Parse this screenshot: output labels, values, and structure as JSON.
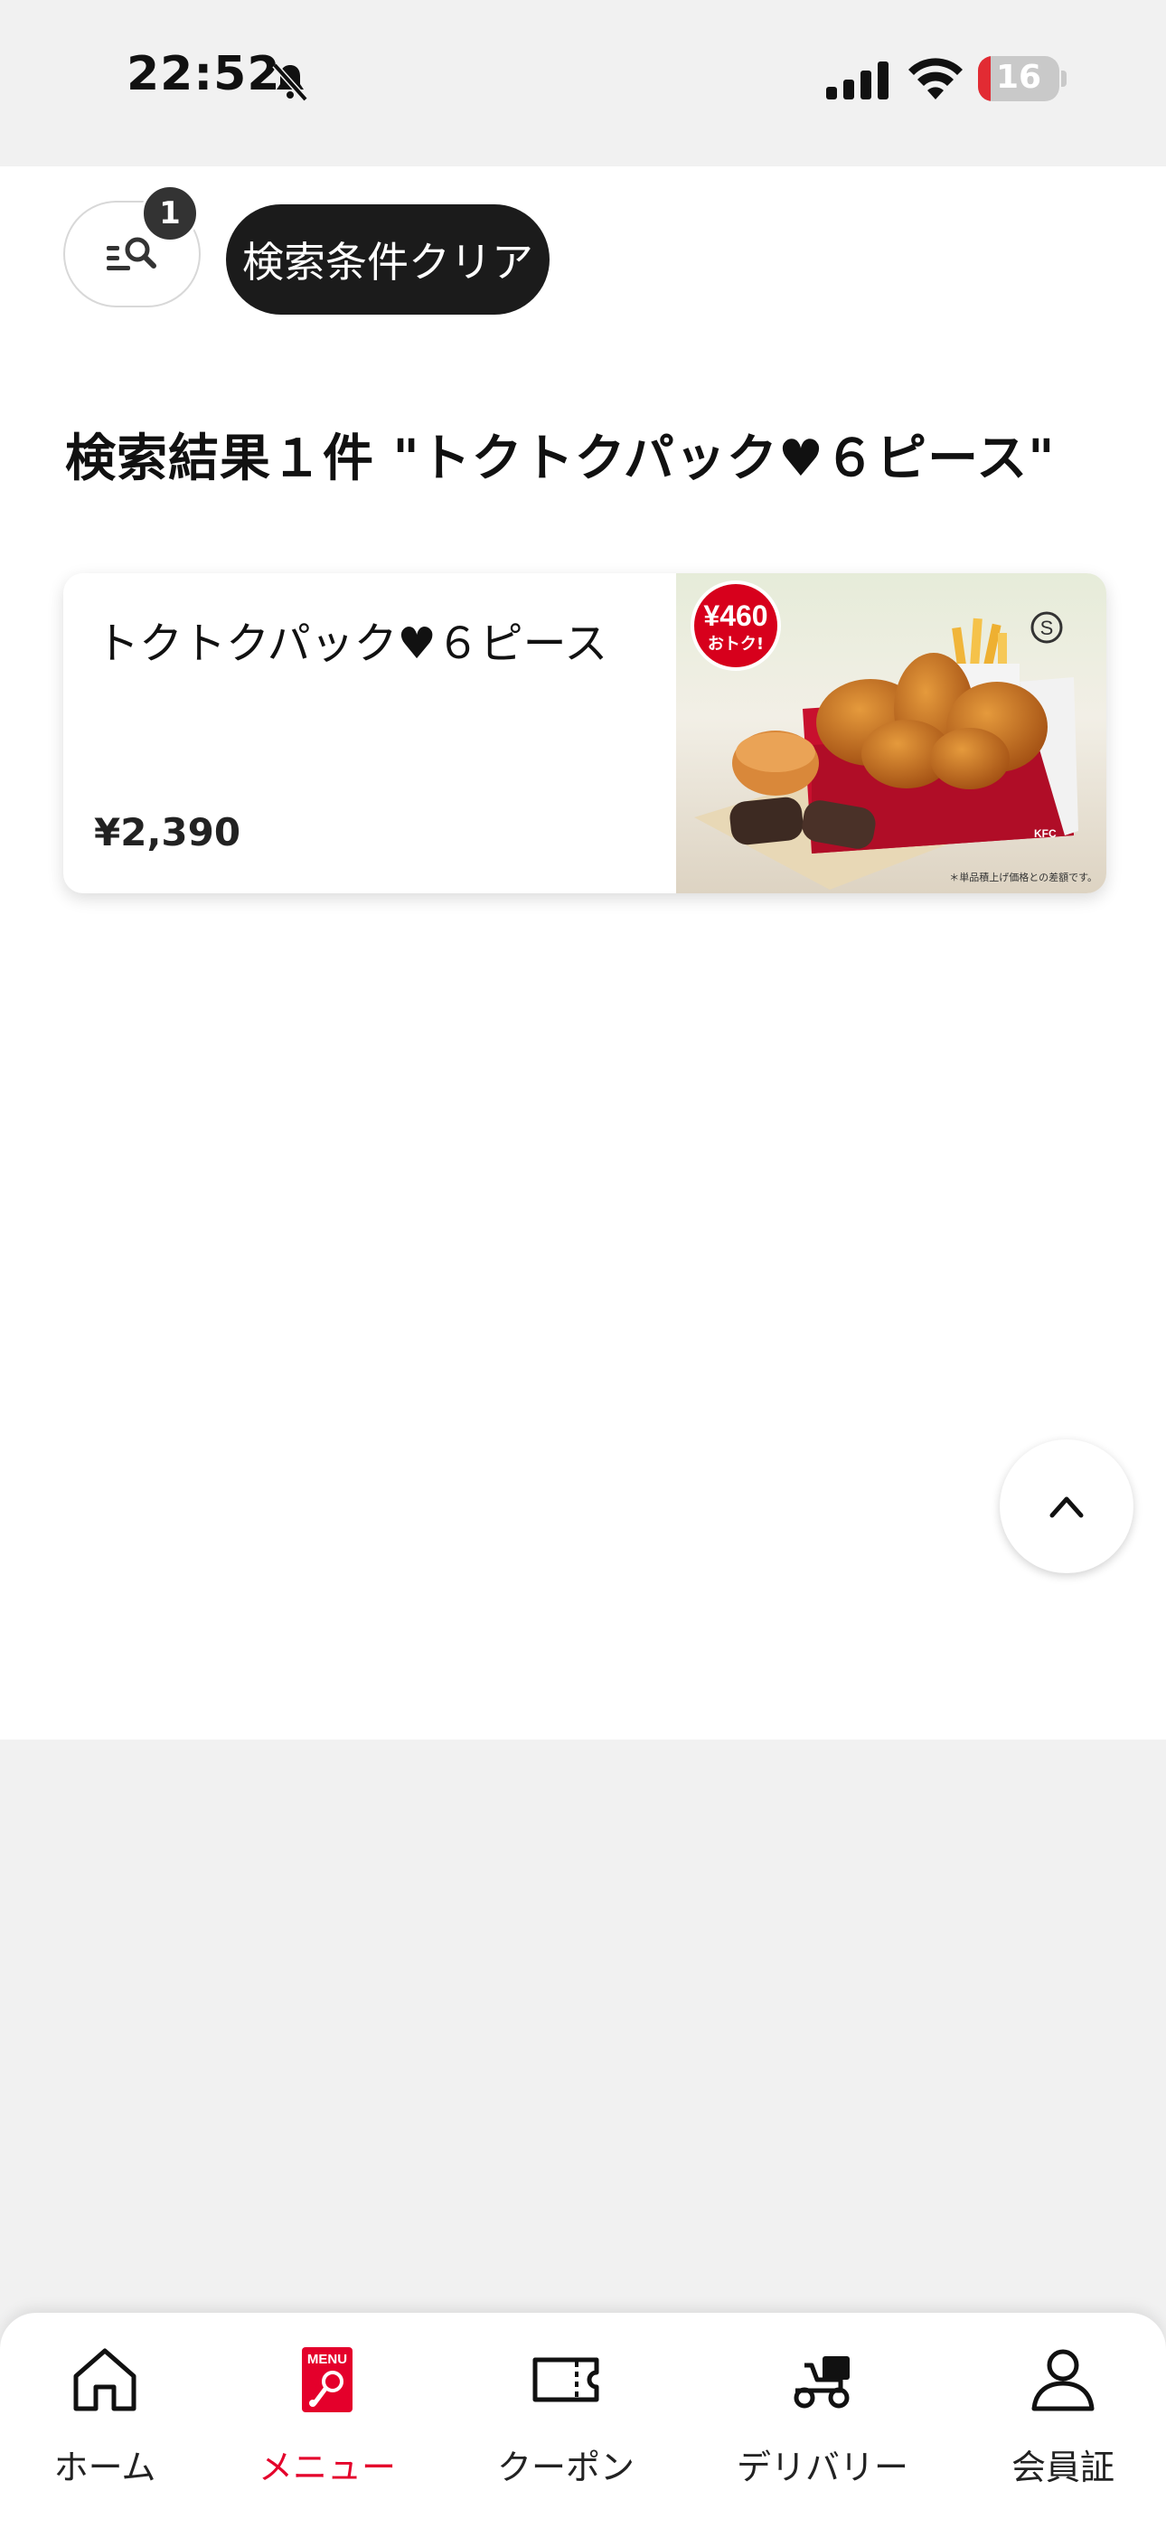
{
  "status_bar": {
    "time": "22:52",
    "battery": "16",
    "battery_level_percent": 16
  },
  "filter": {
    "badge_count": "1",
    "clear_label": "検索条件クリア"
  },
  "results": {
    "title": "検索結果１件 \"トクトクパック♥６ピース\"",
    "items": [
      {
        "name": "トクトクパック♥６ピース",
        "price": "¥2,390",
        "image_badge_price": "¥460",
        "image_badge_sub": "おトク!",
        "image_size_mark": "S",
        "image_brand": "KFC",
        "image_note": "＊単品積上げ価格との差額です。"
      }
    ]
  },
  "tabs": [
    {
      "label": "ホーム",
      "icon": "home-icon",
      "active": false
    },
    {
      "label": "メニュー",
      "icon": "menu-icon",
      "icon_text": "MENU",
      "active": true
    },
    {
      "label": "クーポン",
      "icon": "coupon-icon",
      "active": false
    },
    {
      "label": "デリバリー",
      "icon": "delivery-icon",
      "active": false
    },
    {
      "label": "会員証",
      "icon": "member-icon",
      "active": false
    }
  ],
  "colors": {
    "accent": "#e4002b",
    "dark_button": "#1b1b1b",
    "background": "#f1f1f1"
  }
}
